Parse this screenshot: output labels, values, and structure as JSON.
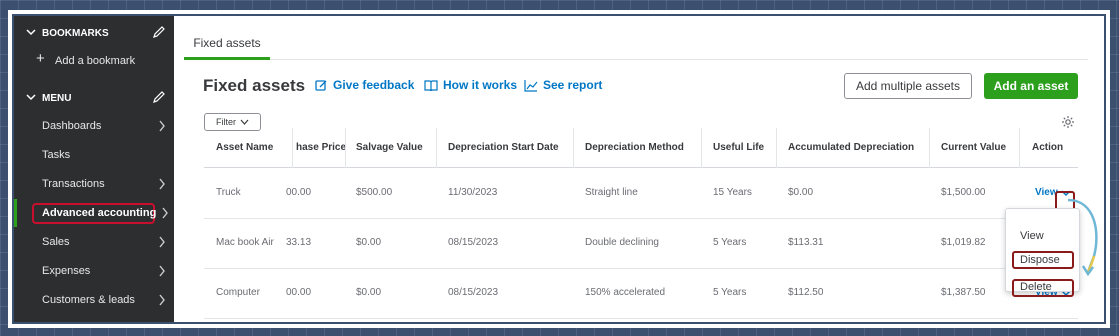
{
  "sidebar": {
    "bookmarks_header": "BOOKMARKS",
    "add_bookmark": "Add a bookmark",
    "menu_header": "MENU",
    "items": [
      {
        "label": "Dashboards",
        "arrow": true
      },
      {
        "label": "Tasks",
        "arrow": false
      },
      {
        "label": "Transactions",
        "arrow": true
      },
      {
        "label": "Advanced accounting",
        "arrow": true,
        "active": true
      },
      {
        "label": "Sales",
        "arrow": true
      },
      {
        "label": "Expenses",
        "arrow": true
      },
      {
        "label": "Customers & leads",
        "arrow": true
      }
    ]
  },
  "main": {
    "tab": "Fixed assets",
    "title": "Fixed assets",
    "links": {
      "feedback": "Give feedback",
      "how_it_works": "How it works",
      "report": "See report"
    },
    "buttons": {
      "add_multiple": "Add multiple assets",
      "add_asset": "Add an asset",
      "filter": "Filter"
    },
    "table": {
      "headers": [
        "Asset Name",
        "hase Price",
        "Salvage Value",
        "Depreciation Start Date",
        "Depreciation Method",
        "Useful Life",
        "Accumulated Depreciation",
        "Current Value",
        "Action"
      ],
      "rows": [
        {
          "name": "Truck",
          "price": "00.00",
          "salvage": "$500.00",
          "start": "11/30/2023",
          "method": "Straight line",
          "life": "15 Years",
          "accum": "$0.00",
          "current": "$1,500.00",
          "action": "View"
        },
        {
          "name": "Mac book Air",
          "price": "33.13",
          "salvage": "$0.00",
          "start": "08/15/2023",
          "method": "Double declining",
          "life": "5 Years",
          "accum": "$113.31",
          "current": "$1,019.82",
          "action": "View"
        },
        {
          "name": "Computer",
          "price": "00.00",
          "salvage": "$0.00",
          "start": "08/15/2023",
          "method": "150% accelerated",
          "life": "5 Years",
          "accum": "$112.50",
          "current": "$1,387.50",
          "action": "View"
        }
      ]
    },
    "dropdown": [
      "View",
      "Dispose",
      "Delete"
    ]
  },
  "colors": {
    "accent_green": "#2ca01c",
    "link_blue": "#0077c5",
    "highlight_red": "#c8102e",
    "sidebar_bg": "#2d2e30"
  }
}
